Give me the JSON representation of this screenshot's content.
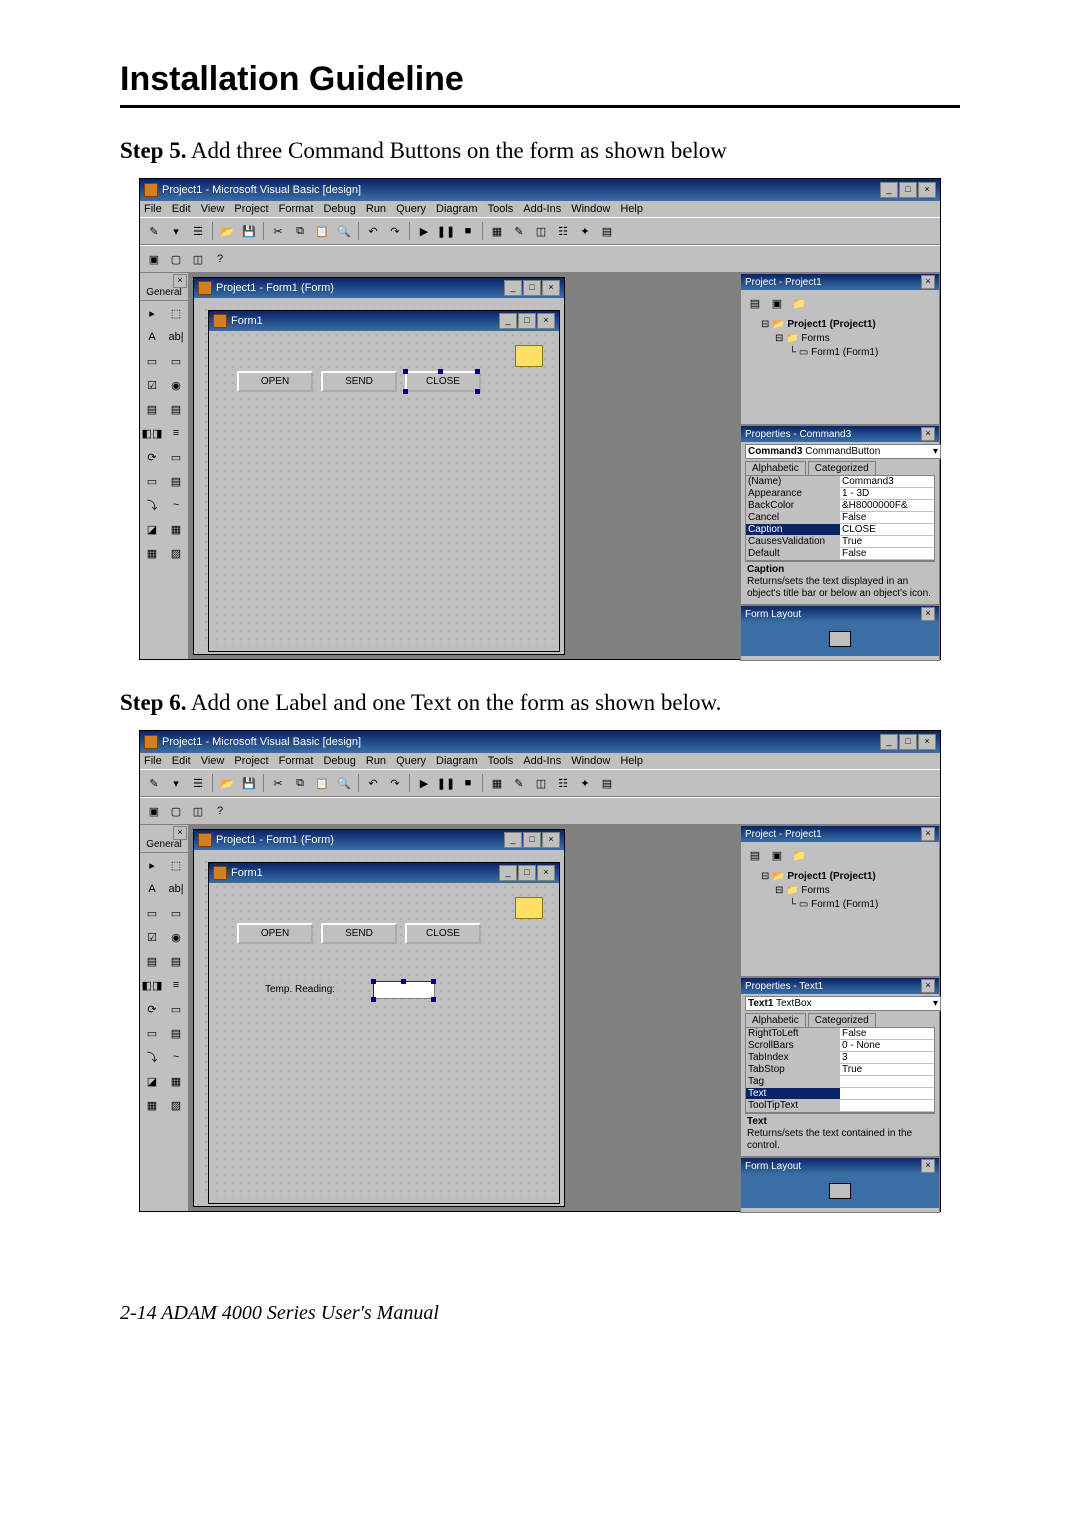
{
  "doc": {
    "title": "Installation Guideline",
    "step5_bold": "Step 5.",
    "step5_text": " Add three Command Buttons on the form as shown below",
    "step6_bold": "Step 6.",
    "step6_text": " Add one Label and one Text on the form as shown below.",
    "footer": "2-14 ADAM 4000 Series User's Manual"
  },
  "vb": {
    "title": "Project1 - Microsoft Visual Basic [design]",
    "menus": [
      "File",
      "Edit",
      "View",
      "Project",
      "Format",
      "Debug",
      "Run",
      "Query",
      "Diagram",
      "Tools",
      "Add-Ins",
      "Window",
      "Help"
    ],
    "toolbox_title": "General",
    "tools": [
      "▸",
      "⬚",
      "A",
      "ab|",
      "▭",
      "▭",
      "☑",
      "◉",
      "▤",
      "▤",
      "◧◨",
      "≡",
      "⟳",
      "▭",
      "▭",
      "▤",
      "⤵",
      "~",
      "◪",
      "▦",
      "▦",
      "▨"
    ],
    "mdi_child_title": "Project1 - Form1 (Form)",
    "form_title": "Form1",
    "buttons": {
      "open": "OPEN",
      "send": "SEND",
      "close": "CLOSE"
    },
    "label1": "Temp. Reading:",
    "project_panel": {
      "title": "Project - Project1",
      "tree_root": "Project1 (Project1)",
      "tree_forms": "Forms",
      "tree_form1": "Form1 (Form1)"
    },
    "props5": {
      "title": "Properties - Command3",
      "combo_bold": "Command3",
      "combo_type": "CommandButton",
      "tabs": [
        "Alphabetic",
        "Categorized"
      ],
      "rows": [
        {
          "k": "(Name)",
          "v": "Command3"
        },
        {
          "k": "Appearance",
          "v": "1 - 3D"
        },
        {
          "k": "BackColor",
          "v": "&H8000000F&"
        },
        {
          "k": "Cancel",
          "v": "False"
        },
        {
          "k": "Caption",
          "v": "CLOSE",
          "sel": true
        },
        {
          "k": "CausesValidation",
          "v": "True"
        },
        {
          "k": "Default",
          "v": "False"
        }
      ],
      "desc_title": "Caption",
      "desc_body": "Returns/sets the text displayed in an object's title bar or below an object's icon."
    },
    "props6": {
      "title": "Properties - Text1",
      "combo_bold": "Text1",
      "combo_type": "TextBox",
      "tabs": [
        "Alphabetic",
        "Categorized"
      ],
      "rows": [
        {
          "k": "RightToLeft",
          "v": "False"
        },
        {
          "k": "ScrollBars",
          "v": "0 - None"
        },
        {
          "k": "TabIndex",
          "v": "3"
        },
        {
          "k": "TabStop",
          "v": "True"
        },
        {
          "k": "Tag",
          "v": ""
        },
        {
          "k": "Text",
          "v": "",
          "sel": true
        },
        {
          "k": "ToolTipText",
          "v": ""
        }
      ],
      "desc_title": "Text",
      "desc_body": "Returns/sets the text contained in the control."
    },
    "formlayout_title": "Form Layout"
  }
}
